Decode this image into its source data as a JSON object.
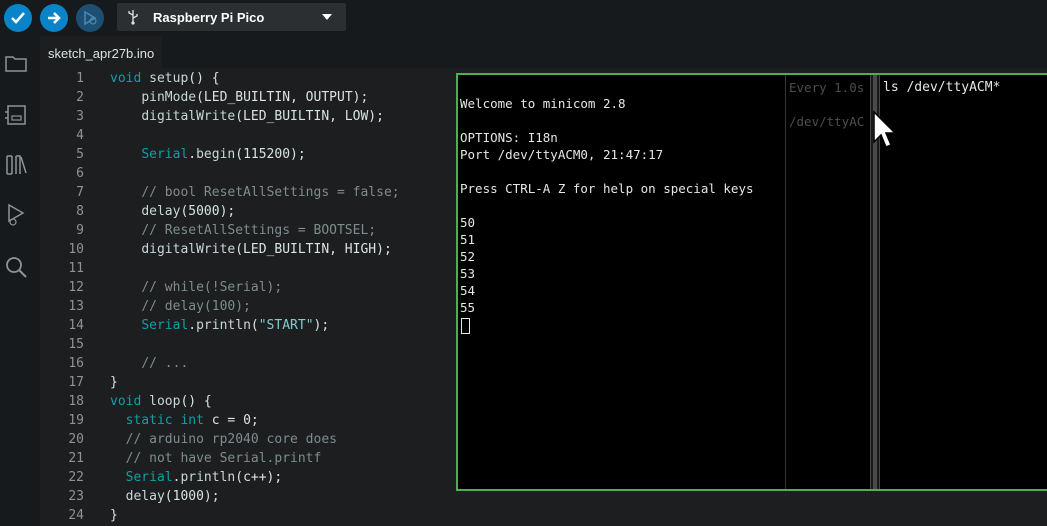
{
  "toolbar": {
    "verify_icon": "checkmark-icon",
    "upload_icon": "arrow-right-icon",
    "debug_icon": "debug-icon",
    "board_name": "Raspberry Pi Pico",
    "board_icon": "usb-icon"
  },
  "activity_bar": [
    "folder-icon",
    "board-manager-icon",
    "library-icon",
    "debug-icon",
    "search-icon"
  ],
  "tab": {
    "label": "sketch_apr27b.ino"
  },
  "editor": {
    "lines": [
      {
        "n": "1",
        "html": "<span class=\"kw\">void</span> <span class=\"fn\">setup</span>() {"
      },
      {
        "n": "2",
        "html": "    <span class=\"fn\">pinMode</span>(LED_BUILTIN, OUTPUT);"
      },
      {
        "n": "3",
        "html": "    <span class=\"fn\">digitalWrite</span>(LED_BUILTIN, LOW);"
      },
      {
        "n": "4",
        "html": ""
      },
      {
        "n": "5",
        "html": "    <span class=\"kw\">Serial</span>.<span class=\"fn\">begin</span>(115200);"
      },
      {
        "n": "6",
        "html": ""
      },
      {
        "n": "7",
        "html": "    <span class=\"cm\">// bool ResetAllSettings = false;</span>"
      },
      {
        "n": "8",
        "html": "    <span class=\"fn\">delay</span>(5000);"
      },
      {
        "n": "9",
        "html": "    <span class=\"cm\">// ResetAllSettings = BOOTSEL;</span>"
      },
      {
        "n": "10",
        "html": "    <span class=\"fn\">digitalWrite</span>(LED_BUILTIN, HIGH);"
      },
      {
        "n": "11",
        "html": ""
      },
      {
        "n": "12",
        "html": "    <span class=\"cm\">// while(!Serial);</span>"
      },
      {
        "n": "13",
        "html": "    <span class=\"cm\">// delay(100);</span>"
      },
      {
        "n": "14",
        "html": "    <span class=\"kw\">Serial</span>.<span class=\"fn\">println</span>(<span class=\"st\">\"START\"</span>);"
      },
      {
        "n": "15",
        "html": ""
      },
      {
        "n": "16",
        "html": "    <span class=\"cm\">// ...</span>"
      },
      {
        "n": "17",
        "html": "}"
      },
      {
        "n": "18",
        "html": "<span class=\"kw\">void</span> <span class=\"fn\">loop</span>() {"
      },
      {
        "n": "19",
        "html": "  <span class=\"kw\">static</span> <span class=\"kw\">int</span> c = 0;"
      },
      {
        "n": "20",
        "html": "  <span class=\"cm\">// arduino rp2040 core does</span>"
      },
      {
        "n": "21",
        "html": "  <span class=\"cm\">// not have Serial.printf</span>"
      },
      {
        "n": "22",
        "html": "  <span class=\"kw\">Serial</span>.<span class=\"fn\">println</span>(c++);"
      },
      {
        "n": "23",
        "html": "  <span class=\"fn\">delay</span>(1000);"
      },
      {
        "n": "24",
        "html": "}"
      }
    ]
  },
  "terminal": {
    "minicom_lines": [
      "",
      "Welcome to minicom 2.8",
      "",
      "OPTIONS: I18n",
      "Port /dev/ttyACM0, 21:47:17",
      "",
      "Press CTRL-A Z for help on special keys",
      "",
      "50",
      "51",
      "52",
      "53",
      "54",
      "55"
    ],
    "watch_header": "Every 1.0s",
    "watch_path": "/dev/ttyAC",
    "ls_command": "ls /dev/ttyACM*"
  },
  "colors": {
    "accent": "#0a84c9",
    "terminal_border": "#4caf50",
    "keyword": "#0ca1a6"
  }
}
